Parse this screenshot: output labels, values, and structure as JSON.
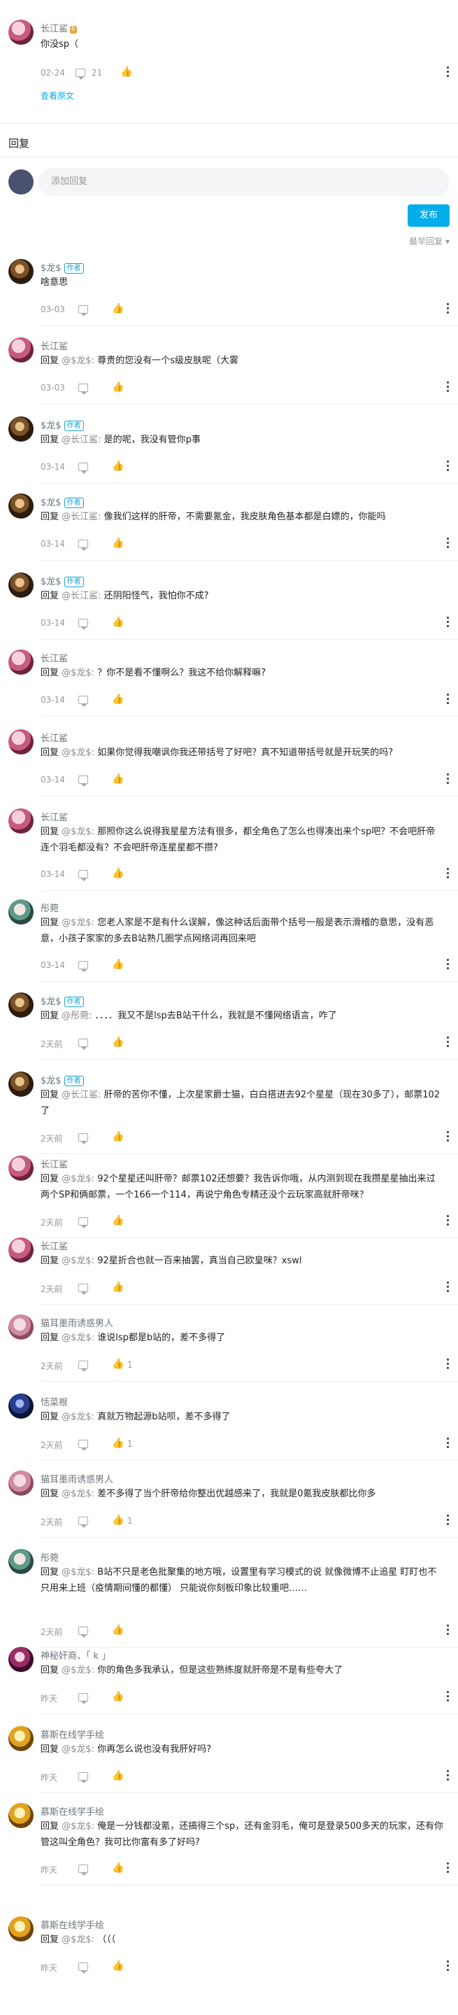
{
  "top": {
    "username": "长江鲨",
    "content": "你没sp（",
    "date": "02-24",
    "like_count": "21",
    "view_replies": "查看原文"
  },
  "section_title": "回复",
  "reply_box": {
    "placeholder": "添加回复",
    "send": "发布"
  },
  "sort": "最早回复",
  "author_tag": "作者",
  "reply_prefix": "回复",
  "comments": [
    {
      "user": "$龙$",
      "tag": true,
      "text": "啥意思",
      "date": "03-03",
      "likes": "",
      "at": ""
    },
    {
      "user": "长江鲨",
      "text": "尊贵的您没有一个s级皮肤呢（大雾",
      "at": "@$龙$:",
      "date": "03-03",
      "likes": ""
    },
    {
      "user": "$龙$",
      "tag": true,
      "text": "是的呢，我没有管你p事",
      "at": "@长江鲨:",
      "date": "03-14",
      "likes": ""
    },
    {
      "user": "$龙$",
      "tag": true,
      "text": "像我们这样的肝帝，不需要氪金，我皮肤角色基本都是白嫖的，你能吗",
      "at": "@长江鲨:",
      "date": "03-14",
      "likes": ""
    },
    {
      "user": "$龙$",
      "tag": true,
      "text": "还阴阳怪气，我怕你不成?",
      "at": "@长江鲨:",
      "date": "03-14",
      "likes": ""
    },
    {
      "user": "长江鲨",
      "text": "？你不是看不懂啊么？我这不给你解释嘛?",
      "at": "@$龙$:",
      "date": "03-14",
      "likes": ""
    },
    {
      "user": "长江鲨",
      "text": "如果你觉得我嘲讽你我还带括号了好吧？真不知道带括号就是开玩笑的吗?",
      "at": "@$龙$:",
      "date": "03-14",
      "likes": ""
    },
    {
      "user": "长江鲨",
      "text": "那照你这么说得我星星方法有很多，都全角色了怎么也得凑出来个sp吧？不会吧肝帝连个羽毛都没有？不会吧肝帝连星星都不攒?",
      "at": "@$龙$:",
      "date": "03-14",
      "likes": ""
    },
    {
      "user": "彤菀",
      "lv": true,
      "text": "您老人家是不是有什么误解，像这种话后面带个括号一般是表示滑稽的意思，没有恶意，小孩子家家的多去B站熟几圈学点网络词再回来吧",
      "at": "@$龙$:",
      "date": "03-14",
      "likes": ""
    },
    {
      "user": "$龙$",
      "tag": true,
      "text": "．．．．我又不是lsp去B站干什么，我就是不懂网络语言，咋了",
      "at": "@彤菀:",
      "date": "2天前",
      "likes": ""
    },
    {
      "user": "$龙$",
      "tag": true,
      "text": "肝帝的苦你不懂，上次星家爵士猫，白白搭进去92个星星（现在30多了），邮票102了",
      "at": "@长江鲨:",
      "date": "2天前",
      "likes": ""
    },
    {
      "user": "长江鲨",
      "text": "92个星星还叫肝帝？邮票102还想要？我告诉你哦，从内测到现在我攒星星抽出来过两个SP和俩邮票，一个166一个114，再说宁角色专精还没个云玩家高就肝帝咪？",
      "at": "@$龙$:",
      "date": "2天前",
      "likes": ""
    },
    {
      "user": "长江鲨",
      "text": "92星折合也就一百来抽罢，真当自己欧皇咪？xswl",
      "at": "@$龙$:",
      "date": "2天前",
      "likes": ""
    },
    {
      "user": "猫耳墨雨诱惑男人",
      "text": "谁说lsp都是b站的，差不多得了",
      "at": "@$龙$:",
      "date": "2天前",
      "likes": "1"
    },
    {
      "user": "恬菜根",
      "text": "真就万物起源b站呗，差不多得了",
      "at": "@$龙$:",
      "date": "2天前",
      "likes": "1"
    },
    {
      "user": "猫耳墨雨诱惑男人",
      "text": "差不多得了当个肝帝给你整出优越感来了，我就是0氪我皮肤都比你多",
      "at": "@$龙$:",
      "date": "2天前",
      "likes": "1"
    },
    {
      "user": "彤菀",
      "lv": true,
      "text": "B站不只是老色批聚集的地方哦，设置里有学习模式的说 就像微博不止追星 盯盯也不只用来上班（疫情期间懂的都懂） 只能说你刻板印象比较重吧……",
      "at": "@$龙$:",
      "date": "2天前",
      "likes": ""
    },
    {
      "user": "神秘奸商、｢ k ｣",
      "text": "你的角色多我承认，但是这些熟练度就肝帝是不是有些夸大了",
      "at": "@$龙$:",
      "date": "昨天",
      "likes": ""
    },
    {
      "user": "慕斯在线学手绘",
      "lv": true,
      "text": "你再怎么说也没有我肝好吗?",
      "at": "@$龙$:",
      "date": "昨天",
      "likes": ""
    },
    {
      "user": "慕斯在线学手绘",
      "lv": true,
      "text": "俺是一分钱都没氪，还搞得三个sp，还有金羽毛，俺可是登录500多天的玩家，还有你管这叫全角色？我可比你富有多了好吗?",
      "at": "@$龙$:",
      "date": "昨天",
      "likes": ""
    },
    {
      "user": "慕斯在线学手绘",
      "lv": true,
      "text": "（（（",
      "at": "@$龙$:",
      "date": "昨天",
      "likes": ""
    }
  ]
}
